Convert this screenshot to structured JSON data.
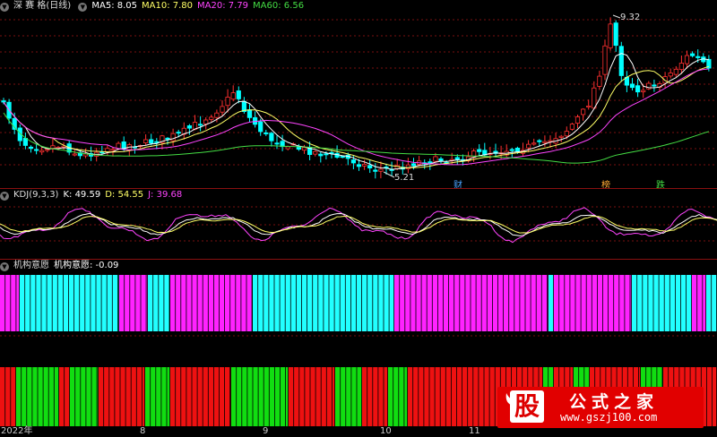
{
  "main": {
    "title": "深 赛 格(日线)",
    "ma": [
      {
        "label": "MA5: 8.05",
        "color": "#ffffff"
      },
      {
        "label": "MA10: 7.80",
        "color": "#ffff66"
      },
      {
        "label": "MA20: 7.79",
        "color": "#ff44ff"
      },
      {
        "label": "MA60: 6.56",
        "color": "#44dd44"
      }
    ],
    "high_label": "9.32",
    "low_label": "5.21",
    "events": [
      {
        "text": "财",
        "color": "#4aa3ff"
      },
      {
        "text": "榜",
        "color": "#ffaa33"
      },
      {
        "text": "跌",
        "color": "#44dd44"
      }
    ]
  },
  "kdj": {
    "name": "KDJ(9,3,3)",
    "k": "K: 49.59",
    "d": "D: 54.55",
    "j": "J: 39.68",
    "colors": {
      "k": "#ffffff",
      "d": "#ffff66",
      "j": "#ff44ff"
    }
  },
  "jgyy": {
    "name": "机构意愿",
    "value": "机构意愿: -0.09",
    "colors": {
      "a": "#ff22ff",
      "b": "#22ffff"
    }
  },
  "bottom": {
    "colors": {
      "red": "#ee1111",
      "green": "#11dd11"
    }
  },
  "xaxis": {
    "labels": [
      "2022年",
      "8",
      "9",
      "10",
      "11"
    ]
  },
  "watermark": {
    "char": "股",
    "name": "公式之家",
    "url": "www.gszj100.com"
  },
  "colors": {
    "up": "#ff3030",
    "down": "#00ffff",
    "grid": "#7a0f0f"
  }
}
